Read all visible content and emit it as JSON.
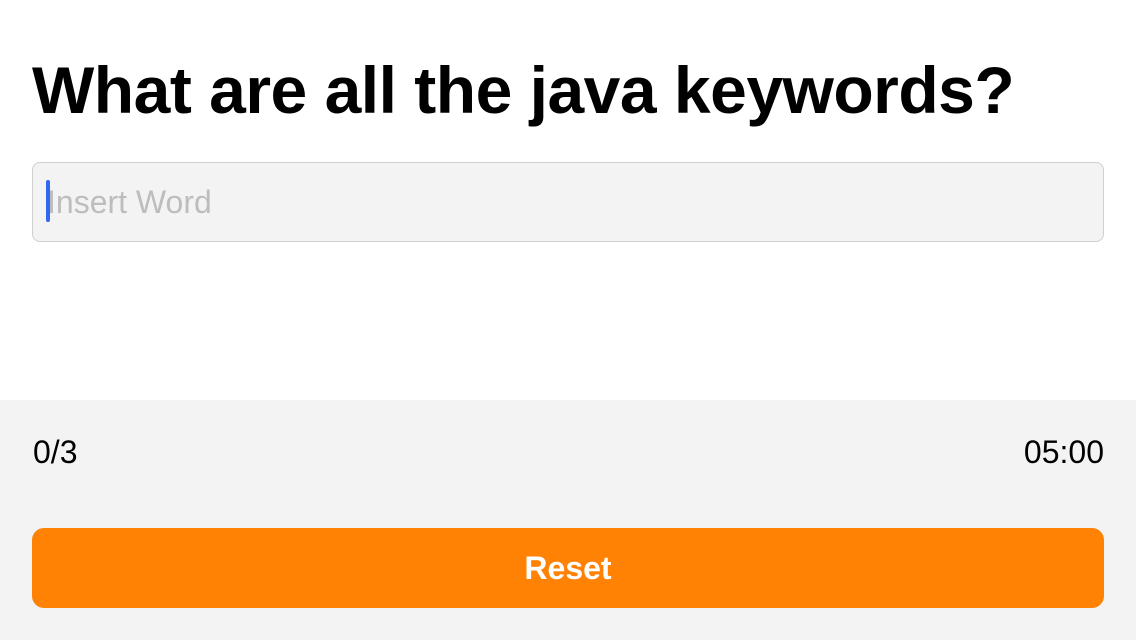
{
  "quiz": {
    "question": "What are all the java keywords?"
  },
  "input": {
    "placeholder": "Insert Word",
    "value": ""
  },
  "status": {
    "score": "0/3",
    "timer": "05:00"
  },
  "actions": {
    "reset_label": "Reset"
  },
  "colors": {
    "accent": "#ff8204",
    "caret": "#3366ee",
    "panel": "#f3f3f3"
  }
}
